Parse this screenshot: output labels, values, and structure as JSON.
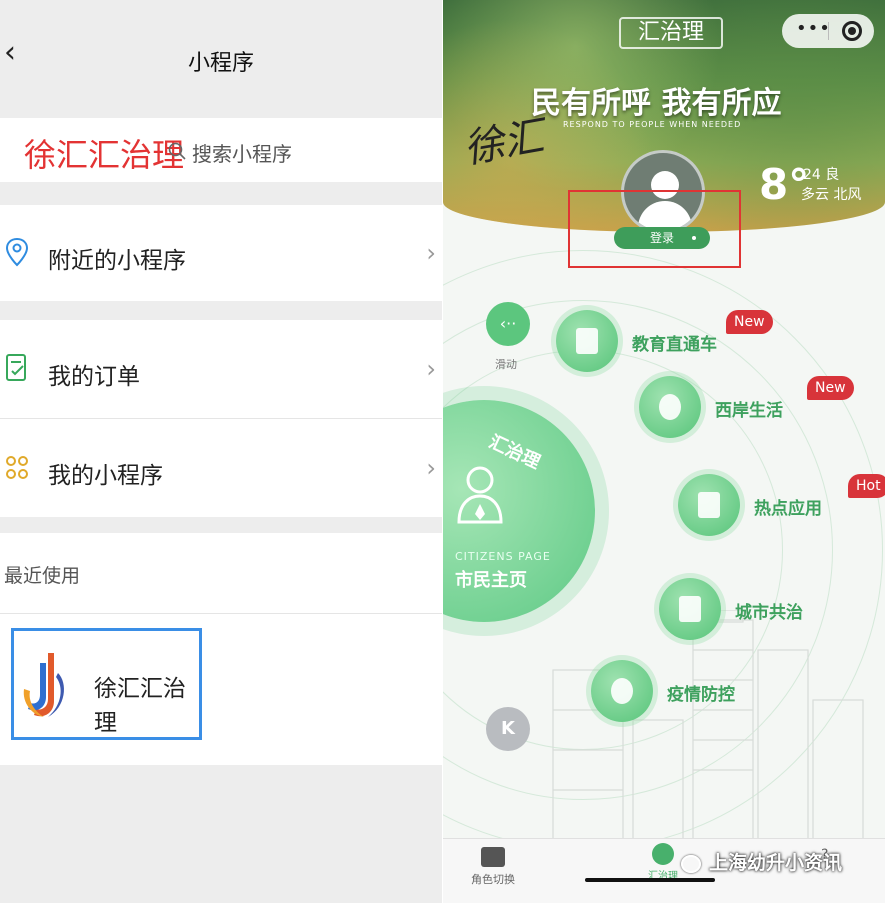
{
  "left": {
    "nav": {
      "back_glyph": "‹",
      "title": "小程序"
    },
    "search": {
      "brand": "徐汇汇治理",
      "placeholder": "搜索小程序"
    },
    "cells": [
      {
        "label": "附近的小程序",
        "icon": "location-pin-icon"
      },
      {
        "label": "我的订单",
        "icon": "order-check-icon"
      },
      {
        "label": "我的小程序",
        "icon": "mini-program-icon"
      }
    ],
    "recent": {
      "header": "最近使用",
      "app_name": "徐汇汇治理"
    }
  },
  "right": {
    "app_title": "汇治理",
    "capsule": {
      "more": "•••"
    },
    "slogan": "民有所呼 我有所应",
    "slogan_en": "RESPOND TO PEOPLE WHEN NEEDED",
    "calligraphy": "徐汇",
    "weather": {
      "temp": "8°",
      "aqi": "24 良",
      "condition": "多云 北风"
    },
    "login": "登录",
    "swipe": {
      "glyph": "‹··",
      "label": "滑动"
    },
    "citizen": {
      "arc": "汇治理",
      "en": "CITIZENS PAGE",
      "cn": "市民主页"
    },
    "menu": [
      {
        "label": "教育直通车",
        "badge": "New"
      },
      {
        "label": "西岸生活",
        "badge": "New"
      },
      {
        "label": "热点应用",
        "badge": "Hot"
      },
      {
        "label": "城市共治",
        "badge": ""
      },
      {
        "label": "疫情防控",
        "badge": ""
      }
    ],
    "k_glyph": "K",
    "tabs": [
      {
        "label": "角色切换"
      },
      {
        "label": "汇治理"
      }
    ],
    "watermark": "上海幼升小资讯"
  },
  "colors": {
    "brand_red": "#e33333",
    "green": "#3ea15e",
    "badge_red": "#d8343a",
    "highlight_blue": "#3a8ee6"
  }
}
